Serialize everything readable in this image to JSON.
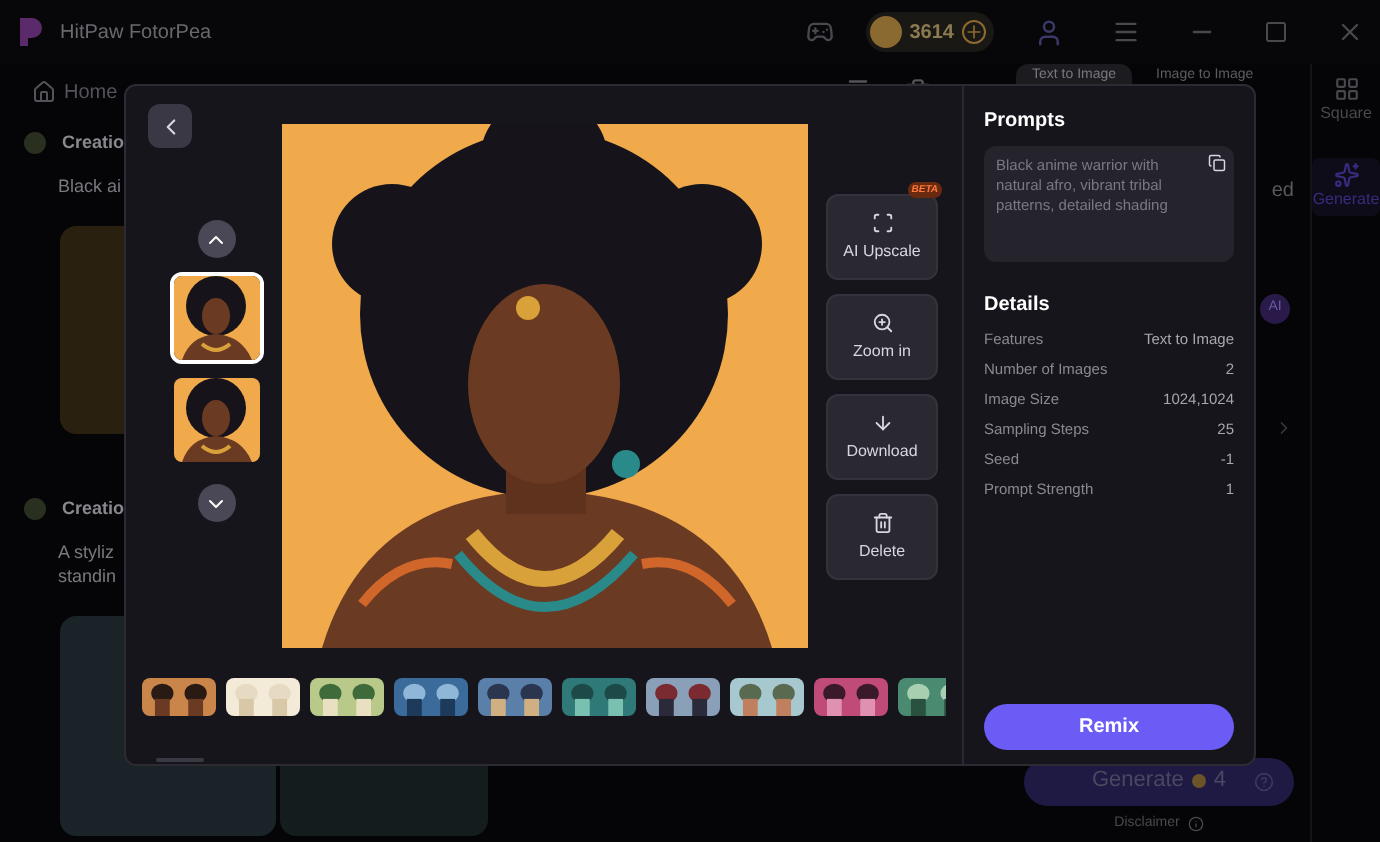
{
  "app": {
    "title": "HitPaw FotorPea",
    "coins": "3614"
  },
  "nav": {
    "home": "Home"
  },
  "sections": [
    {
      "title": "Creatio",
      "lines": [
        "Black ai"
      ]
    },
    {
      "title": "Creatio",
      "lines": [
        "A styliz",
        "standin"
      ]
    }
  ],
  "panel": {
    "tabs": [
      {
        "label": "Text to Image",
        "selected": true
      },
      {
        "label": "Image to Image",
        "selected": false
      }
    ],
    "fragment": "ed",
    "badge": "AI",
    "generate": {
      "label": "Generate",
      "cost": "4"
    },
    "disclaimer": "Disclaimer"
  },
  "sidebar": [
    {
      "label": "Square",
      "selected": false
    },
    {
      "label": "Generate",
      "selected": true
    }
  ],
  "viewer": {
    "thumbnails": [
      {
        "kind": "picture",
        "selected": true
      },
      {
        "kind": "picture",
        "selected": false
      }
    ],
    "actions": [
      {
        "kind": "upscale",
        "label": "AI Upscale",
        "badge": "BETA"
      },
      {
        "kind": "zoom",
        "label": "Zoom in"
      },
      {
        "kind": "download",
        "label": "Download"
      },
      {
        "kind": "delete",
        "label": "Delete"
      }
    ],
    "filmstrip": [
      {
        "kind": "picture"
      },
      {
        "kind": "picture"
      },
      {
        "kind": "picture"
      },
      {
        "kind": "picture"
      },
      {
        "kind": "picture"
      },
      {
        "kind": "picture"
      },
      {
        "kind": "picture"
      },
      {
        "kind": "picture"
      },
      {
        "kind": "picture"
      },
      {
        "kind": "picture"
      }
    ],
    "prompts": {
      "title": "Prompts",
      "text": "Black anime warrior with natural afro, vibrant tribal patterns, detailed shading"
    },
    "details": {
      "title": "Details",
      "rows": [
        {
          "label": "Features",
          "value": "Text to Image"
        },
        {
          "label": "Number of Images",
          "value": "2"
        },
        {
          "label": "Image Size",
          "value": "1024,1024"
        },
        {
          "label": "Sampling Steps",
          "value": "25"
        },
        {
          "label": "Seed",
          "value": "-1"
        },
        {
          "label": "Prompt Strength",
          "value": "1"
        }
      ]
    },
    "remix": "Remix"
  }
}
